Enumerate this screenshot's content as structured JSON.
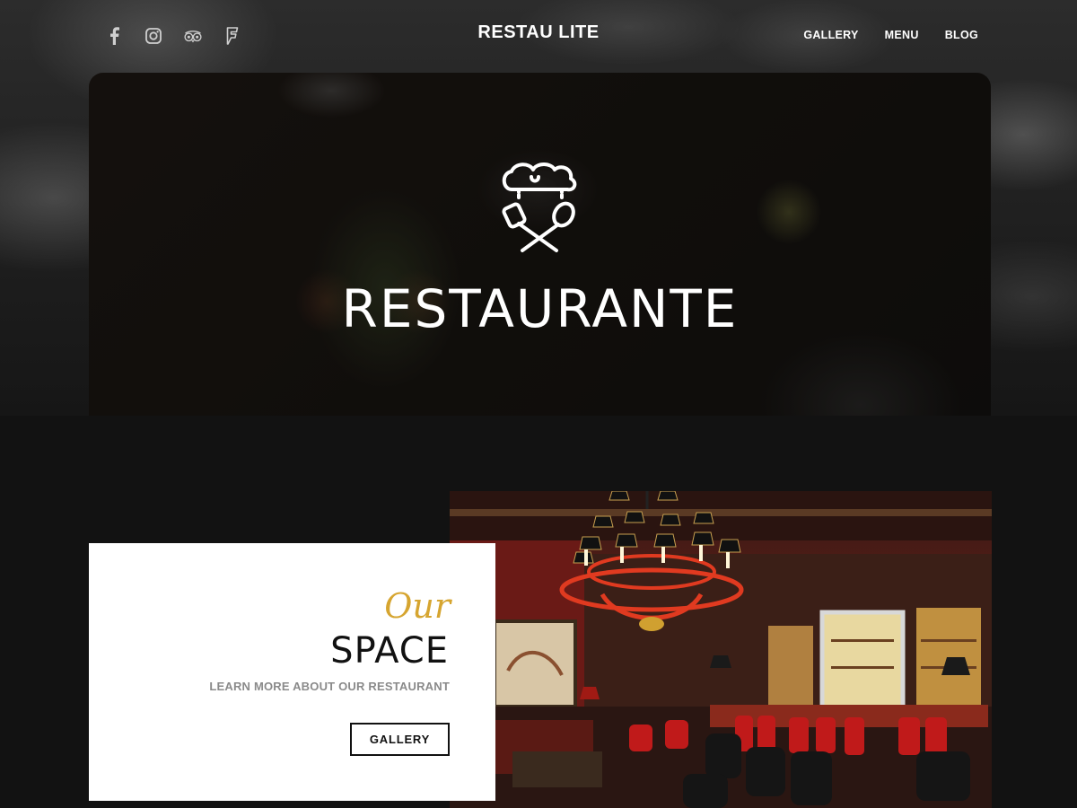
{
  "header": {
    "brand": "RESTAU LITE",
    "social": [
      {
        "icon": "facebook-icon"
      },
      {
        "icon": "instagram-icon"
      },
      {
        "icon": "tripadvisor-icon"
      },
      {
        "icon": "foursquare-icon"
      }
    ],
    "nav": [
      {
        "label": "GALLERY"
      },
      {
        "label": "MENU"
      },
      {
        "label": "BLOG"
      }
    ]
  },
  "hero": {
    "logo_icon": "chef-hat-utensils-icon",
    "title": "RESTAURANTE"
  },
  "space": {
    "script": "Our",
    "title": "SPACE",
    "subtitle": "LEARN MORE ABOUT OUR RESTAURANT",
    "button_label": "GALLERY",
    "image": "restaurant-interior-image"
  },
  "colors": {
    "accent_gold": "#d6a530",
    "background": "#121212",
    "text_light": "#ffffff"
  }
}
